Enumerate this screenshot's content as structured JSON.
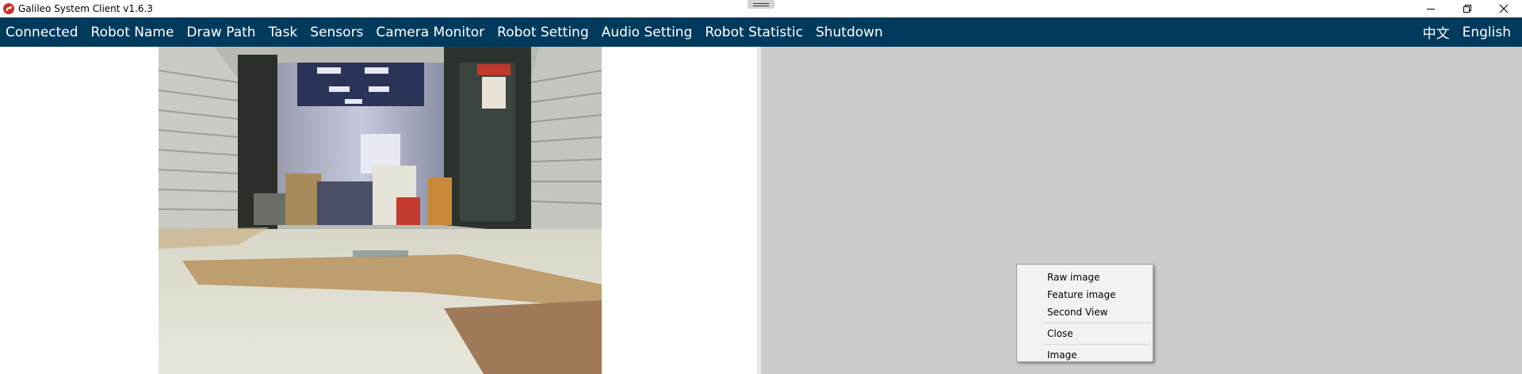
{
  "window": {
    "title": "Galileo System Client v1.6.3",
    "icon": "galileo-app-icon",
    "controls": {
      "minimize_icon": "minimize-icon",
      "restore_icon": "restore-icon",
      "close_icon": "close-icon"
    }
  },
  "menu": {
    "items": [
      {
        "label": "Connected"
      },
      {
        "label": "Robot Name"
      },
      {
        "label": "Draw Path"
      },
      {
        "label": "Task"
      },
      {
        "label": "Sensors"
      },
      {
        "label": "Camera Monitor"
      },
      {
        "label": "Robot Setting"
      },
      {
        "label": "Audio Setting"
      },
      {
        "label": "Robot Statistic"
      },
      {
        "label": "Shutdown"
      }
    ],
    "languages": [
      {
        "label": "中文"
      },
      {
        "label": "English"
      }
    ]
  },
  "context_menu": {
    "items": [
      {
        "label": "Raw image"
      },
      {
        "label": "Feature image"
      },
      {
        "label": "Second View"
      },
      {
        "label": "Close"
      },
      {
        "label": "Image"
      }
    ]
  },
  "colors": {
    "menubar_bg": "#003a5c",
    "right_pane_bg": "#cbcbcb",
    "app_icon": "#d12e22"
  }
}
